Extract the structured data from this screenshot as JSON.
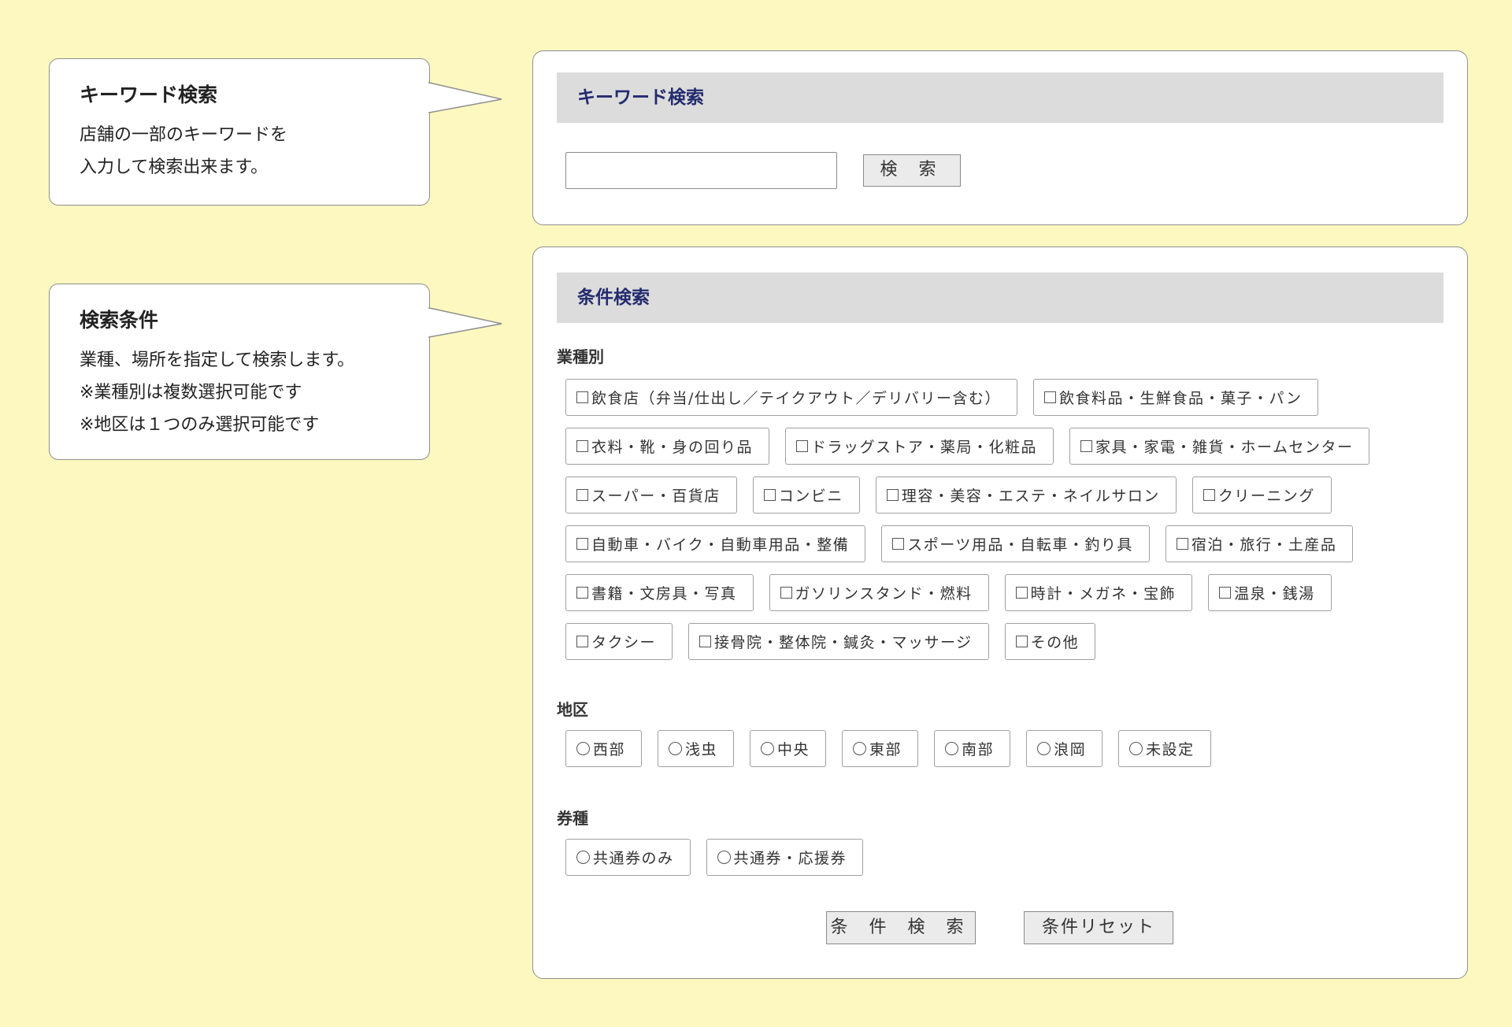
{
  "callouts": {
    "keyword": {
      "title": "キーワード検索",
      "lines": [
        "店舗の一部のキーワードを",
        "入力して検索出来ます。"
      ]
    },
    "conditions": {
      "title": "検索条件",
      "lines": [
        "業種、場所を指定して検索します。",
        "※業種別は複数選択可能です",
        "※地区は１つのみ選択可能です"
      ]
    }
  },
  "keyword_panel": {
    "heading": "キーワード検索",
    "input_value": "",
    "search_button": "検 索"
  },
  "condition_panel": {
    "heading": "条件検索",
    "industry_label": "業種別",
    "industries": [
      "飲食店（弁当/仕出し／テイクアウト／デリバリー含む）",
      "飲食料品・生鮮食品・菓子・パン",
      "衣料・靴・身の回り品",
      "ドラッグストア・薬局・化粧品",
      "家具・家電・雑貨・ホームセンター",
      "スーパー・百貨店",
      "コンビニ",
      "理容・美容・エステ・ネイルサロン",
      "クリーニング",
      "自動車・バイク・自動車用品・整備",
      "スポーツ用品・自転車・釣り具",
      "宿泊・旅行・土産品",
      "書籍・文房具・写真",
      "ガソリンスタンド・燃料",
      "時計・メガネ・宝飾",
      "温泉・銭湯",
      "タクシー",
      "接骨院・整体院・鍼灸・マッサージ",
      "その他"
    ],
    "district_label": "地区",
    "districts": [
      "西部",
      "浅虫",
      "中央",
      "東部",
      "南部",
      "浪岡",
      "未設定"
    ],
    "ticket_label": "券種",
    "tickets": [
      "共通券のみ",
      "共通券・応援券"
    ],
    "search_button": "条 件 検 索",
    "reset_button": "条件リセット"
  }
}
